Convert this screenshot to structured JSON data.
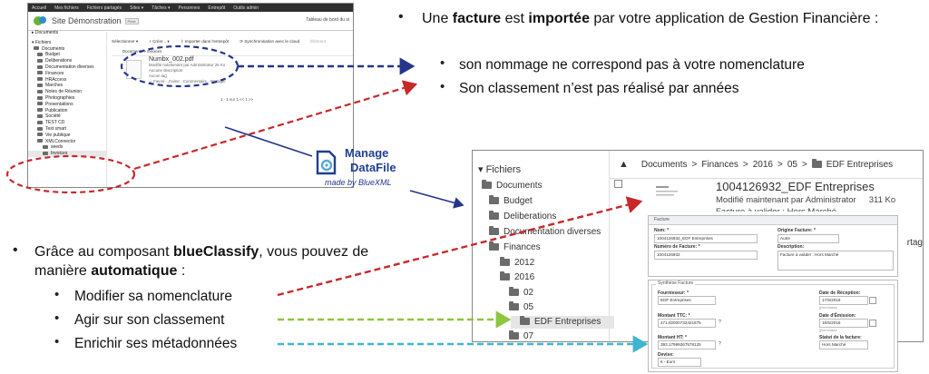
{
  "top_bullet": {
    "parts": [
      "Une ",
      "facture",
      " est ",
      "importée",
      " par votre application de Gestion Financière :"
    ],
    "sub": [
      "son nommage ne correspond pas à votre nomenclature",
      "Son classement n’est pas réalisé par années"
    ]
  },
  "bottom_bullet": {
    "parts": [
      "Grâce au composant ",
      "blueClassify",
      ", vous pouvez de manière ",
      "automatique",
      " :"
    ],
    "sub": [
      "Modifier sa nomenclature",
      "Agir sur son classement",
      "Enrichir ses métadonnées"
    ]
  },
  "logo": {
    "line1": "Manage",
    "line2": "DataFile",
    "tagline": "made by BlueXML"
  },
  "colors": {
    "dark_blue": "#24358c",
    "red": "#c8282a",
    "green": "#8dc63f",
    "cyan": "#3fb6d0"
  },
  "shot1": {
    "topnav": [
      "Accueil",
      "Mes fichiers",
      "Fichiers partagés",
      "Sites ▾",
      "Tâches ▾",
      "Personnes",
      "Entrepôt",
      "Outils admin"
    ],
    "site_title": "Site Démonstration",
    "site_badge": "Privé",
    "dashboard_label": "Tableau de bord du si",
    "tree_heading_docs": "▸ Documents",
    "tree_heading_files": "▾ Fichiers",
    "tree_items": [
      "Documents",
      "Budget",
      "Deliberations",
      "Documentation diverses",
      "Finances",
      "HRAccess",
      "Marches",
      "Notes de Réunion",
      "Photographies",
      "Presentations",
      "Publication",
      "Société",
      "TEST CD",
      "Test smart",
      "Vie publique",
      "XMLConnector",
      "seeds",
      "Invoices"
    ],
    "toolbar": [
      "Sélectionner ▾",
      "+ Créer... ▾",
      "⇪ Importer dans l'entrepôt",
      "⟳ Synchronisation avec le cloud",
      "Élément"
    ],
    "crumb": "Documents > Invoices",
    "file_name": "Numbx_002.pdf",
    "file_meta": [
      "Modifié maintenant par Administrator  26 Ko",
      "Aucune description",
      "Aucun tag"
    ],
    "file_actions": "☆ Favori  ·  J'aime  ·  Commentaire  ·  Partager",
    "pager": "1 - 1 sur 1   <<   1   >>"
  },
  "shot2": {
    "tree_title": "▾ Fichiers",
    "tree": [
      "Documents",
      "Budget",
      "Deliberations",
      "Documentation diverses",
      "Finances",
      "2012",
      "2016",
      "02",
      "05",
      "EDF Entreprises",
      "07"
    ],
    "crumbs": [
      "Documents",
      "Finances",
      "2016",
      "05",
      "EDF Entreprises"
    ],
    "crumb_sep": ">",
    "doc_title": "1004126932_EDF Entreprises",
    "doc_modified": "Modifié maintenant par Administrator",
    "doc_size": "311 Ko",
    "doc_cut_line": "Facture à valider : Hors Marché",
    "right_cut": "rtag",
    "form": {
      "header": "Facture",
      "nom_label": "Nom: *",
      "nom_value": "1004126932_EDF Entreprises",
      "numero_label": "Numéro de Facture: *",
      "numero_value": "1004126932",
      "origine_label": "Origine Facture: *",
      "origine_value": "Autre",
      "description_label": "Description:",
      "description_value": "Facture à valider : Hors Marché",
      "synthese_legend": "Synthèse Facture",
      "fournisseur_label": "Fournisseur: *",
      "fournisseur_value": "EDF Entreprises",
      "ttc_label": "Montant TTC: *",
      "ttc_value": "471.82000732421875",
      "ht_label": "Montant HT: *",
      "ht_value": "393.17999267578125",
      "devise_label": "Devise:",
      "devise_value": "€ - Euro",
      "reception_label": "Date de Réception:",
      "reception_value": "17/5/2016",
      "emission_label": "Date d'Émission:",
      "emission_value": "16/5/2016",
      "statut_label": "Statut de la facture:",
      "statut_value": "Hors Marché",
      "date_hint": "jj/mm/aaaa",
      "help": "?"
    }
  }
}
